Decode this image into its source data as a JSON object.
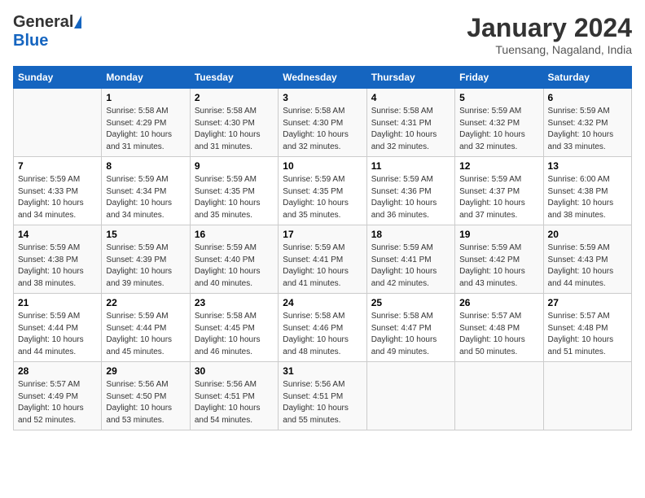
{
  "logo": {
    "general": "General",
    "blue": "Blue"
  },
  "header": {
    "month": "January 2024",
    "location": "Tuensang, Nagaland, India"
  },
  "weekdays": [
    "Sunday",
    "Monday",
    "Tuesday",
    "Wednesday",
    "Thursday",
    "Friday",
    "Saturday"
  ],
  "weeks": [
    [
      {
        "day": "",
        "info": ""
      },
      {
        "day": "1",
        "info": "Sunrise: 5:58 AM\nSunset: 4:29 PM\nDaylight: 10 hours\nand 31 minutes."
      },
      {
        "day": "2",
        "info": "Sunrise: 5:58 AM\nSunset: 4:30 PM\nDaylight: 10 hours\nand 31 minutes."
      },
      {
        "day": "3",
        "info": "Sunrise: 5:58 AM\nSunset: 4:30 PM\nDaylight: 10 hours\nand 32 minutes."
      },
      {
        "day": "4",
        "info": "Sunrise: 5:58 AM\nSunset: 4:31 PM\nDaylight: 10 hours\nand 32 minutes."
      },
      {
        "day": "5",
        "info": "Sunrise: 5:59 AM\nSunset: 4:32 PM\nDaylight: 10 hours\nand 32 minutes."
      },
      {
        "day": "6",
        "info": "Sunrise: 5:59 AM\nSunset: 4:32 PM\nDaylight: 10 hours\nand 33 minutes."
      }
    ],
    [
      {
        "day": "7",
        "info": "Sunrise: 5:59 AM\nSunset: 4:33 PM\nDaylight: 10 hours\nand 34 minutes."
      },
      {
        "day": "8",
        "info": "Sunrise: 5:59 AM\nSunset: 4:34 PM\nDaylight: 10 hours\nand 34 minutes."
      },
      {
        "day": "9",
        "info": "Sunrise: 5:59 AM\nSunset: 4:35 PM\nDaylight: 10 hours\nand 35 minutes."
      },
      {
        "day": "10",
        "info": "Sunrise: 5:59 AM\nSunset: 4:35 PM\nDaylight: 10 hours\nand 35 minutes."
      },
      {
        "day": "11",
        "info": "Sunrise: 5:59 AM\nSunset: 4:36 PM\nDaylight: 10 hours\nand 36 minutes."
      },
      {
        "day": "12",
        "info": "Sunrise: 5:59 AM\nSunset: 4:37 PM\nDaylight: 10 hours\nand 37 minutes."
      },
      {
        "day": "13",
        "info": "Sunrise: 6:00 AM\nSunset: 4:38 PM\nDaylight: 10 hours\nand 38 minutes."
      }
    ],
    [
      {
        "day": "14",
        "info": "Sunrise: 5:59 AM\nSunset: 4:38 PM\nDaylight: 10 hours\nand 38 minutes."
      },
      {
        "day": "15",
        "info": "Sunrise: 5:59 AM\nSunset: 4:39 PM\nDaylight: 10 hours\nand 39 minutes."
      },
      {
        "day": "16",
        "info": "Sunrise: 5:59 AM\nSunset: 4:40 PM\nDaylight: 10 hours\nand 40 minutes."
      },
      {
        "day": "17",
        "info": "Sunrise: 5:59 AM\nSunset: 4:41 PM\nDaylight: 10 hours\nand 41 minutes."
      },
      {
        "day": "18",
        "info": "Sunrise: 5:59 AM\nSunset: 4:41 PM\nDaylight: 10 hours\nand 42 minutes."
      },
      {
        "day": "19",
        "info": "Sunrise: 5:59 AM\nSunset: 4:42 PM\nDaylight: 10 hours\nand 43 minutes."
      },
      {
        "day": "20",
        "info": "Sunrise: 5:59 AM\nSunset: 4:43 PM\nDaylight: 10 hours\nand 44 minutes."
      }
    ],
    [
      {
        "day": "21",
        "info": "Sunrise: 5:59 AM\nSunset: 4:44 PM\nDaylight: 10 hours\nand 44 minutes."
      },
      {
        "day": "22",
        "info": "Sunrise: 5:59 AM\nSunset: 4:44 PM\nDaylight: 10 hours\nand 45 minutes."
      },
      {
        "day": "23",
        "info": "Sunrise: 5:58 AM\nSunset: 4:45 PM\nDaylight: 10 hours\nand 46 minutes."
      },
      {
        "day": "24",
        "info": "Sunrise: 5:58 AM\nSunset: 4:46 PM\nDaylight: 10 hours\nand 48 minutes."
      },
      {
        "day": "25",
        "info": "Sunrise: 5:58 AM\nSunset: 4:47 PM\nDaylight: 10 hours\nand 49 minutes."
      },
      {
        "day": "26",
        "info": "Sunrise: 5:57 AM\nSunset: 4:48 PM\nDaylight: 10 hours\nand 50 minutes."
      },
      {
        "day": "27",
        "info": "Sunrise: 5:57 AM\nSunset: 4:48 PM\nDaylight: 10 hours\nand 51 minutes."
      }
    ],
    [
      {
        "day": "28",
        "info": "Sunrise: 5:57 AM\nSunset: 4:49 PM\nDaylight: 10 hours\nand 52 minutes."
      },
      {
        "day": "29",
        "info": "Sunrise: 5:56 AM\nSunset: 4:50 PM\nDaylight: 10 hours\nand 53 minutes."
      },
      {
        "day": "30",
        "info": "Sunrise: 5:56 AM\nSunset: 4:51 PM\nDaylight: 10 hours\nand 54 minutes."
      },
      {
        "day": "31",
        "info": "Sunrise: 5:56 AM\nSunset: 4:51 PM\nDaylight: 10 hours\nand 55 minutes."
      },
      {
        "day": "",
        "info": ""
      },
      {
        "day": "",
        "info": ""
      },
      {
        "day": "",
        "info": ""
      }
    ]
  ]
}
